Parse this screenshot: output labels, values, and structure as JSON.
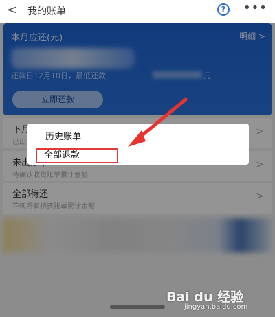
{
  "header": {
    "back_glyph": "<",
    "title": "我的账单",
    "help_glyph": "?",
    "more_glyph": "•••"
  },
  "card": {
    "label": "本月应还(元)",
    "detail_link": "明细 >",
    "due_text": "还款日12月10日，最低还款",
    "due_suffix": "元",
    "repay_button": "立即还款"
  },
  "list": [
    {
      "title": "下月账单累计",
      "sub": "已出账单",
      "chevron": ">"
    },
    {
      "title": "未出账单",
      "sub": "待确认收货账单累计金额",
      "chevron": ">"
    },
    {
      "title": "全部待还",
      "sub": "花呗所有待还账单累计金额",
      "chevron": ">"
    }
  ],
  "menu": {
    "items": [
      "历史账单",
      "全部退款"
    ],
    "highlighted_index": 1
  },
  "watermark": {
    "logo": "Bai du 经验",
    "url": "jingyan.baidu.com"
  },
  "colors": {
    "primary_blue": "#1f66d6",
    "highlight_red": "#e03a3a"
  }
}
